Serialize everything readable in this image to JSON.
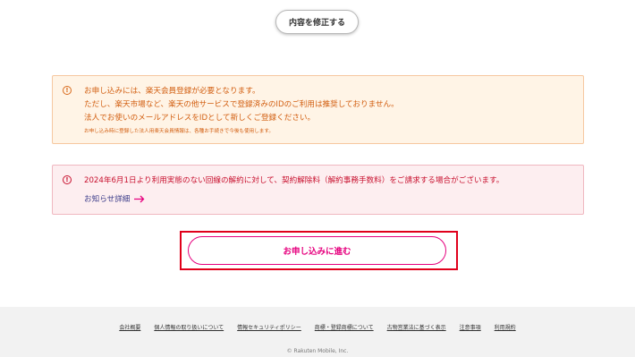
{
  "top": {
    "edit_label": "内容を修正する"
  },
  "notice_orange": {
    "icon": "info-icon",
    "color": "#d25e10",
    "lines": [
      "お申し込みには、楽天会員登録が必要となります。",
      "ただし、楽天市場など、楽天の他サービスで登録済みのIDのご利用は推奨しておりません。",
      "法人でお使いのメールアドレスをIDとして新しくご登録ください。"
    ],
    "small": "お申し込み時に登録した法人用楽天会員情報は、各種お手続きで今後も使用します。"
  },
  "notice_red": {
    "icon": "info-icon",
    "color": "#c8102e",
    "text": "2024年6月1日より利用実態のない回線の解約に対して、契約解除料（解約事務手数料）をご請求する場合がございます。",
    "link_label": "お知らせ詳細",
    "link_icon": "arrow-right-icon"
  },
  "action": {
    "apply_label": "お申し込みに進む",
    "accent": "#e6007e"
  },
  "footer": {
    "links": [
      "会社概要",
      "個人情報の取り扱いについて",
      "情報セキュリティポリシー",
      "商標・登録商標について",
      "古物営業法に基づく表示",
      "注意事項",
      "利用規約"
    ],
    "copyright": "© Rakuten Mobile, Inc."
  }
}
